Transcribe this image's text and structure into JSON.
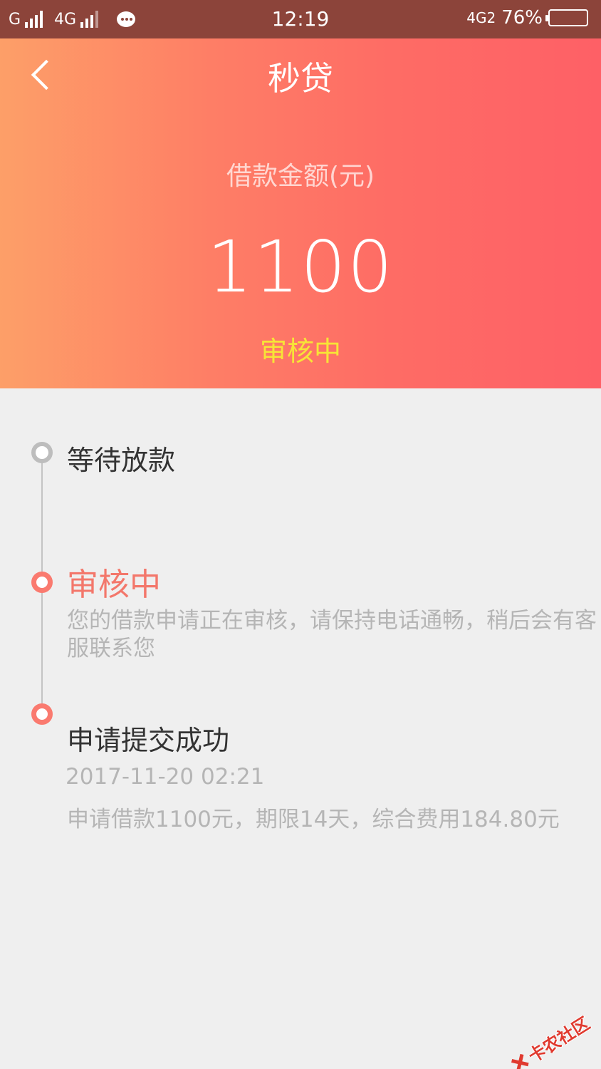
{
  "status_bar": {
    "carrier1": "G",
    "carrier2": "4G",
    "time": "12:19",
    "network_right": "4G2",
    "battery_percent": "76%",
    "battery_level": 0.76
  },
  "header": {
    "title": "秒贷",
    "amount_label": "借款金额(元)",
    "amount_value": "1100",
    "status": "审核中"
  },
  "timeline": {
    "step1": {
      "title": "等待放款"
    },
    "step2": {
      "title": "审核中",
      "desc": "您的借款申请正在审核，请保持电话通畅，稍后会有客服联系您"
    },
    "step3": {
      "title": "申请提交成功",
      "time": "2017-11-20 02:21",
      "desc": "申请借款1100元，期限14天，综合费用184.80元"
    }
  },
  "watermark": {
    "text": "卡农社区"
  },
  "colors": {
    "accent": "#fe6c65",
    "status_yellow": "#f7e437",
    "timeline_red": "#f3776b"
  }
}
